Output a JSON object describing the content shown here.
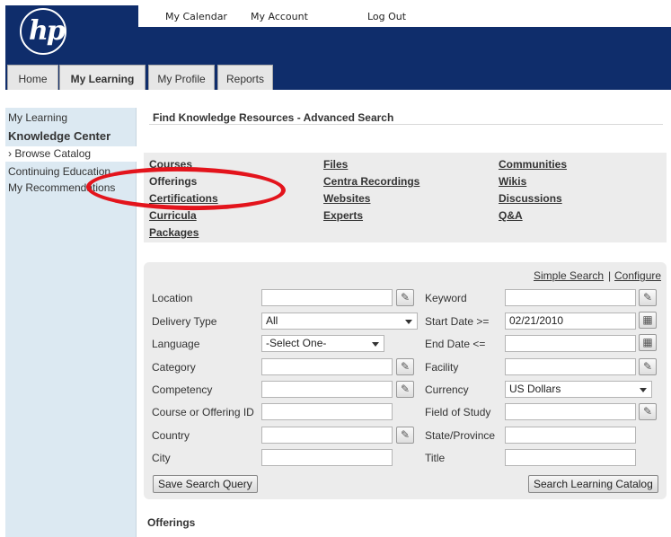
{
  "header": {
    "logo_text": "hp",
    "top_links": [
      "My Calendar",
      "My Account",
      "Log Out"
    ],
    "tabs": [
      {
        "label": "Home"
      },
      {
        "label": "My Learning"
      },
      {
        "label": "My Profile"
      },
      {
        "label": "Reports"
      }
    ]
  },
  "sidebar": {
    "items": [
      {
        "label": "My Learning"
      },
      {
        "label": "Knowledge Center"
      },
      {
        "label": "› Browse Catalog"
      },
      {
        "label": "Continuing Education"
      },
      {
        "label": "My Recommendations"
      }
    ]
  },
  "main": {
    "title": "Find Knowledge Resources - Advanced Search",
    "resources": {
      "col1": [
        "Courses",
        "Offerings",
        "Certifications",
        "Curricula",
        "Packages"
      ],
      "col2": [
        "Files",
        "Centra Recordings",
        "Websites",
        "Experts"
      ],
      "col3": [
        "Communities",
        "Wikis",
        "Discussions",
        "Q&A"
      ]
    },
    "search": {
      "simple_search": "Simple Search",
      "separator": "|",
      "configure": "Configure",
      "left_fields": [
        {
          "label": "Location",
          "value": ""
        },
        {
          "label": "Delivery Type",
          "value": "All"
        },
        {
          "label": "Language",
          "value": "-Select One-"
        },
        {
          "label": "Category",
          "value": ""
        },
        {
          "label": "Competency",
          "value": ""
        },
        {
          "label": "Course or Offering ID",
          "value": ""
        },
        {
          "label": "Country",
          "value": ""
        },
        {
          "label": "City",
          "value": ""
        }
      ],
      "right_fields": [
        {
          "label": "Keyword",
          "value": ""
        },
        {
          "label": "Start Date >=",
          "value": "02/21/2010"
        },
        {
          "label": "End Date <=",
          "value": ""
        },
        {
          "label": "Facility",
          "value": ""
        },
        {
          "label": "Currency",
          "value": "US Dollars"
        },
        {
          "label": "Field of Study",
          "value": ""
        },
        {
          "label": "State/Province",
          "value": ""
        },
        {
          "label": "Title",
          "value": ""
        }
      ],
      "save_button": "Save Search Query",
      "search_button": "Search Learning Catalog"
    },
    "results_heading": "Offerings"
  },
  "colors": {
    "brand_blue": "#0f2d6b",
    "sidebar_bg": "#dce9f2",
    "panel_bg": "#ececec",
    "annotation_red": "#e3141c"
  },
  "icons": {
    "lookup": "magnifier-pencil-icon",
    "calendar": "calendar-icon",
    "dropdown": "chevron-down-icon"
  }
}
